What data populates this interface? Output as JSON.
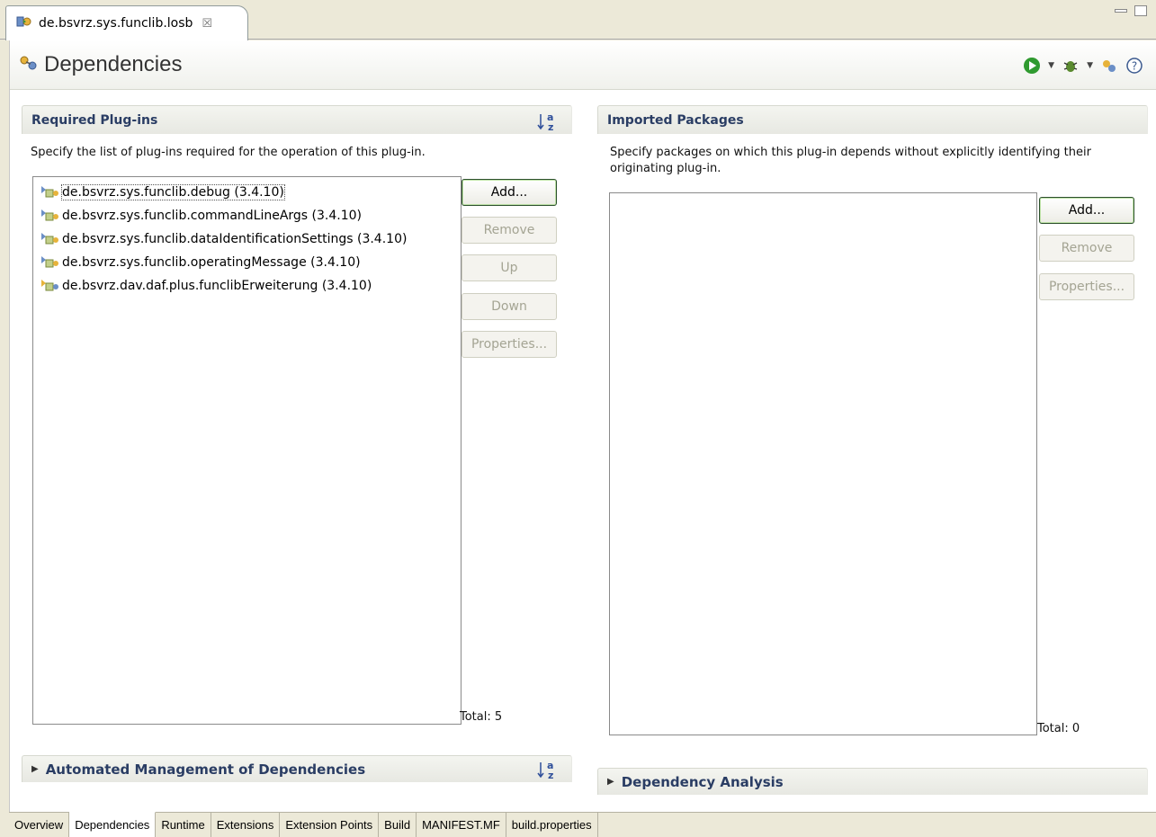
{
  "editor_tab": {
    "title": "de.bsvrz.sys.funclib.losb",
    "close_glyph": "☒"
  },
  "form": {
    "title": "Dependencies",
    "header_icons": [
      "run-icon",
      "debug-icon",
      "manifest-icon",
      "help-icon"
    ]
  },
  "required": {
    "title": "Required Plug-ins",
    "description": "Specify the list of plug-ins required for the operation of this plug-in.",
    "items": [
      {
        "label": "de.bsvrz.sys.funclib.debug (3.4.10)",
        "icon": "plugin-icon"
      },
      {
        "label": "de.bsvrz.sys.funclib.commandLineArgs (3.4.10)",
        "icon": "plugin-icon"
      },
      {
        "label": "de.bsvrz.sys.funclib.dataIdentificationSettings (3.4.10)",
        "icon": "plugin-icon"
      },
      {
        "label": "de.bsvrz.sys.funclib.operatingMessage (3.4.10)",
        "icon": "plugin-icon"
      },
      {
        "label": "de.bsvrz.dav.daf.plus.funclibErweiterung (3.4.10)",
        "icon": "plugin-icon"
      }
    ],
    "buttons": {
      "add": "Add...",
      "remove": "Remove",
      "up": "Up",
      "down": "Down",
      "properties": "Properties..."
    },
    "total": "Total: 5"
  },
  "imported": {
    "title": "Imported Packages",
    "description": "Specify packages on which this plug-in depends without explicitly identifying their originating plug-in.",
    "buttons": {
      "add": "Add...",
      "remove": "Remove",
      "properties": "Properties..."
    },
    "total": "Total: 0"
  },
  "automated": {
    "title": "Automated Management of Dependencies"
  },
  "analysis": {
    "title": "Dependency Analysis"
  },
  "page_tabs": [
    "Overview",
    "Dependencies",
    "Runtime",
    "Extensions",
    "Extension Points",
    "Build",
    "MANIFEST.MF",
    "build.properties"
  ],
  "active_page_tab": "Dependencies"
}
